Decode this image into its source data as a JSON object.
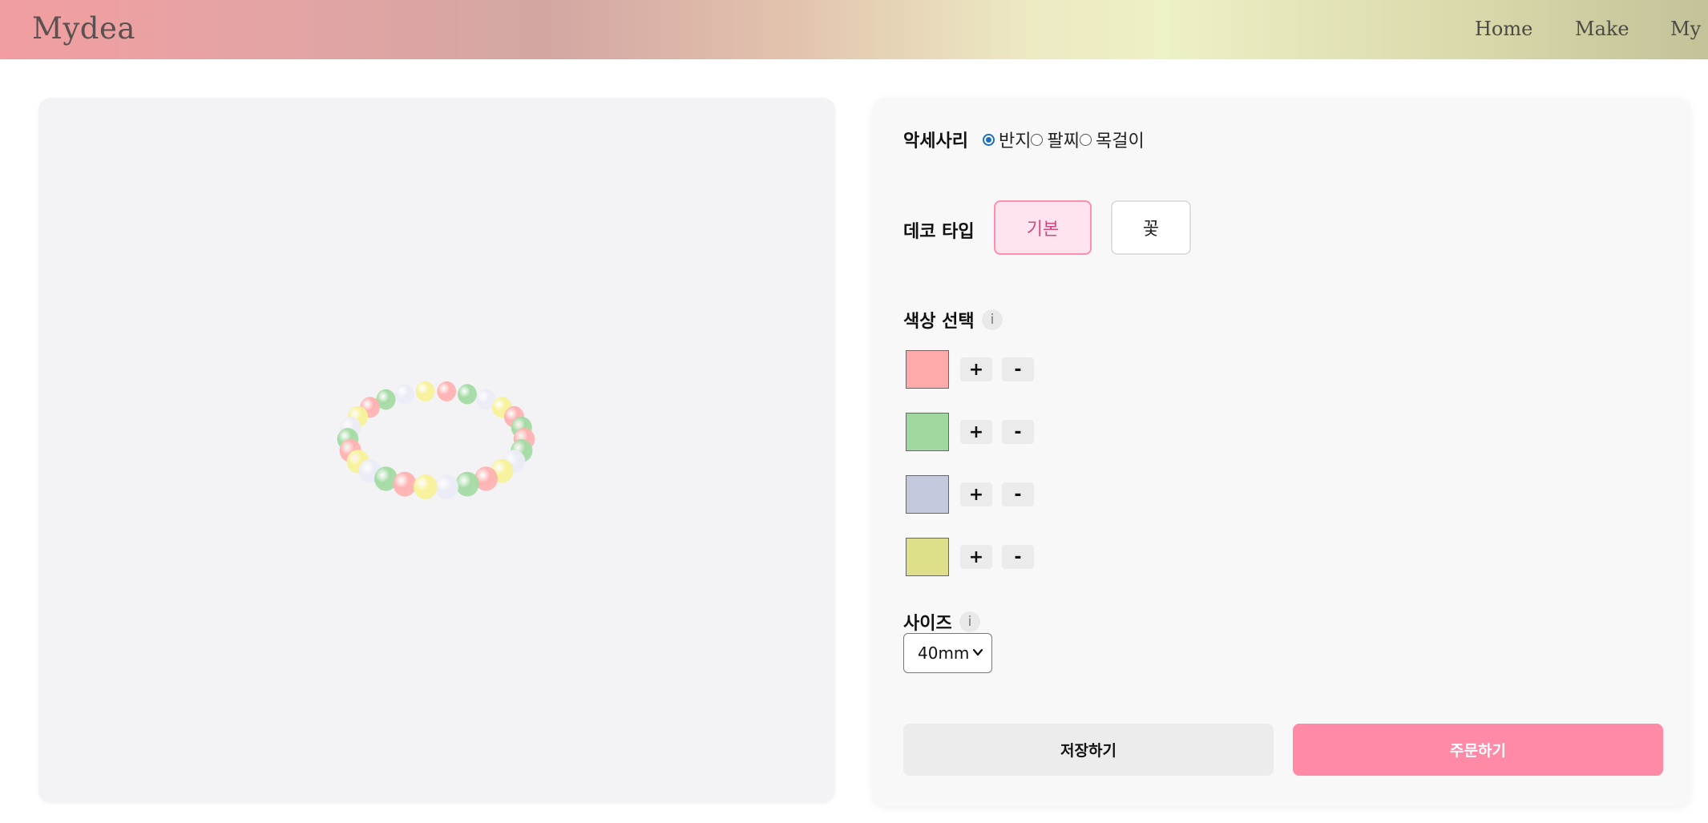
{
  "header": {
    "logo": "Mydea",
    "nav": [
      "Home",
      "Make",
      "My"
    ]
  },
  "viewer": {
    "bead_colors": [
      "#ffb3b3",
      "#a5dba5",
      "#ececf7",
      "#f7f29a"
    ]
  },
  "panel": {
    "accessory": {
      "label": "악세사리",
      "options": [
        "반지",
        "팔찌",
        "목걸이"
      ],
      "selected": "반지"
    },
    "deco": {
      "label": "데코 타입",
      "options": [
        "기본",
        "꽃"
      ],
      "selected": "기본"
    },
    "colors": {
      "label": "색상 선택",
      "info": "i",
      "plus": "+",
      "minus": "-",
      "swatches": [
        "#ffaaaa",
        "#a0d9a0",
        "#c5c9de",
        "#dddf8a"
      ]
    },
    "size": {
      "label": "사이즈",
      "info": "i",
      "value": "40mm"
    },
    "actions": {
      "save": "저장하기",
      "order": "주문하기"
    }
  },
  "theme": {
    "accent_pink": "#ff8aa6",
    "active_border": "#ff8fb1",
    "active_bg": "#ffe3ee"
  }
}
